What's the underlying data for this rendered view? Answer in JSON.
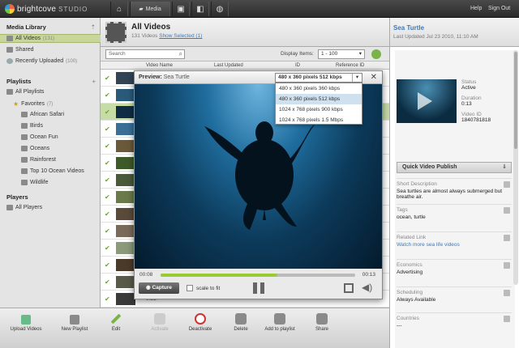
{
  "topbar": {
    "logo_name": "brightcove",
    "logo_suffix": "STUDIO",
    "media_label": "Media",
    "help": "Help",
    "signout": "Sign Out"
  },
  "sidebar": {
    "library_title": "Media Library",
    "library": [
      {
        "label": "All Videos",
        "count": "(131)"
      },
      {
        "label": "Shared",
        "count": ""
      },
      {
        "label": "Recently Uploaded",
        "count": "(100)"
      }
    ],
    "playlists_title": "Playlists",
    "all_playlists": "All Playlists",
    "favorites": "Favorites",
    "favorites_count": "(7)",
    "fav_items": [
      "African Safari",
      "Birds",
      "Ocean Fun",
      "Oceans",
      "Rainforest",
      "Top 10 Ocean Videos",
      "Wildlife"
    ],
    "players_title": "Players",
    "all_players": "All Players",
    "upload_label": "Upload Videos",
    "newplaylist_label": "New Playlist"
  },
  "main": {
    "title": "All Videos",
    "count_text": "131 Videos",
    "show_selected": "Show Selected (1)",
    "search_placeholder": "Search",
    "display_label": "Display Items:",
    "display_value": "1 - 100",
    "columns": {
      "name": "Video Name",
      "updated": "Last Updated",
      "id": "ID",
      "ref": "Reference ID"
    },
    "toolbar": {
      "edit": "Edit",
      "activate": "Activate",
      "deactivate": "Deactivate",
      "delete": "Delete",
      "add": "Add to playlist",
      "share": "Share"
    },
    "row_time": "0:31"
  },
  "modal": {
    "label": "Preview:",
    "video": "Sea Turtle",
    "rendition": "480 x 360 pixels 512 kbps",
    "options": [
      "480 x 360 pixels 360 kbps",
      "480 x 360 pixels 512 kbps",
      "1024 x 768 pixels 900 kbps",
      "1024 x 768 pixels 1.5 Mbps"
    ],
    "time_current": "00:08",
    "time_total": "00:13",
    "progress": 0.6,
    "capture": "Capture",
    "scale": "scale to fit"
  },
  "details": {
    "title": "Sea Turtle",
    "updated": "Last Updated Jul 23 2010, 11:10 AM",
    "status_k": "Status",
    "status_v": "Active",
    "duration_k": "Duration",
    "duration_v": "0:13",
    "videoid_k": "Video ID",
    "videoid_v": "1840781818",
    "quick_publish": "Quick Video Publish",
    "short_desc_k": "Short Description",
    "short_desc_v": "Sea turtles are almost always submerged but breathe air.",
    "tags_k": "Tags",
    "tags_v": "ocean, turtle",
    "link_k": "Related Link",
    "link_v": "Watch more sea life videos",
    "econ_k": "Economics",
    "econ_v": "Advertising",
    "sched_k": "Scheduling",
    "sched_v": "Always Available",
    "countries_k": "Countries",
    "countries_v": "---"
  }
}
